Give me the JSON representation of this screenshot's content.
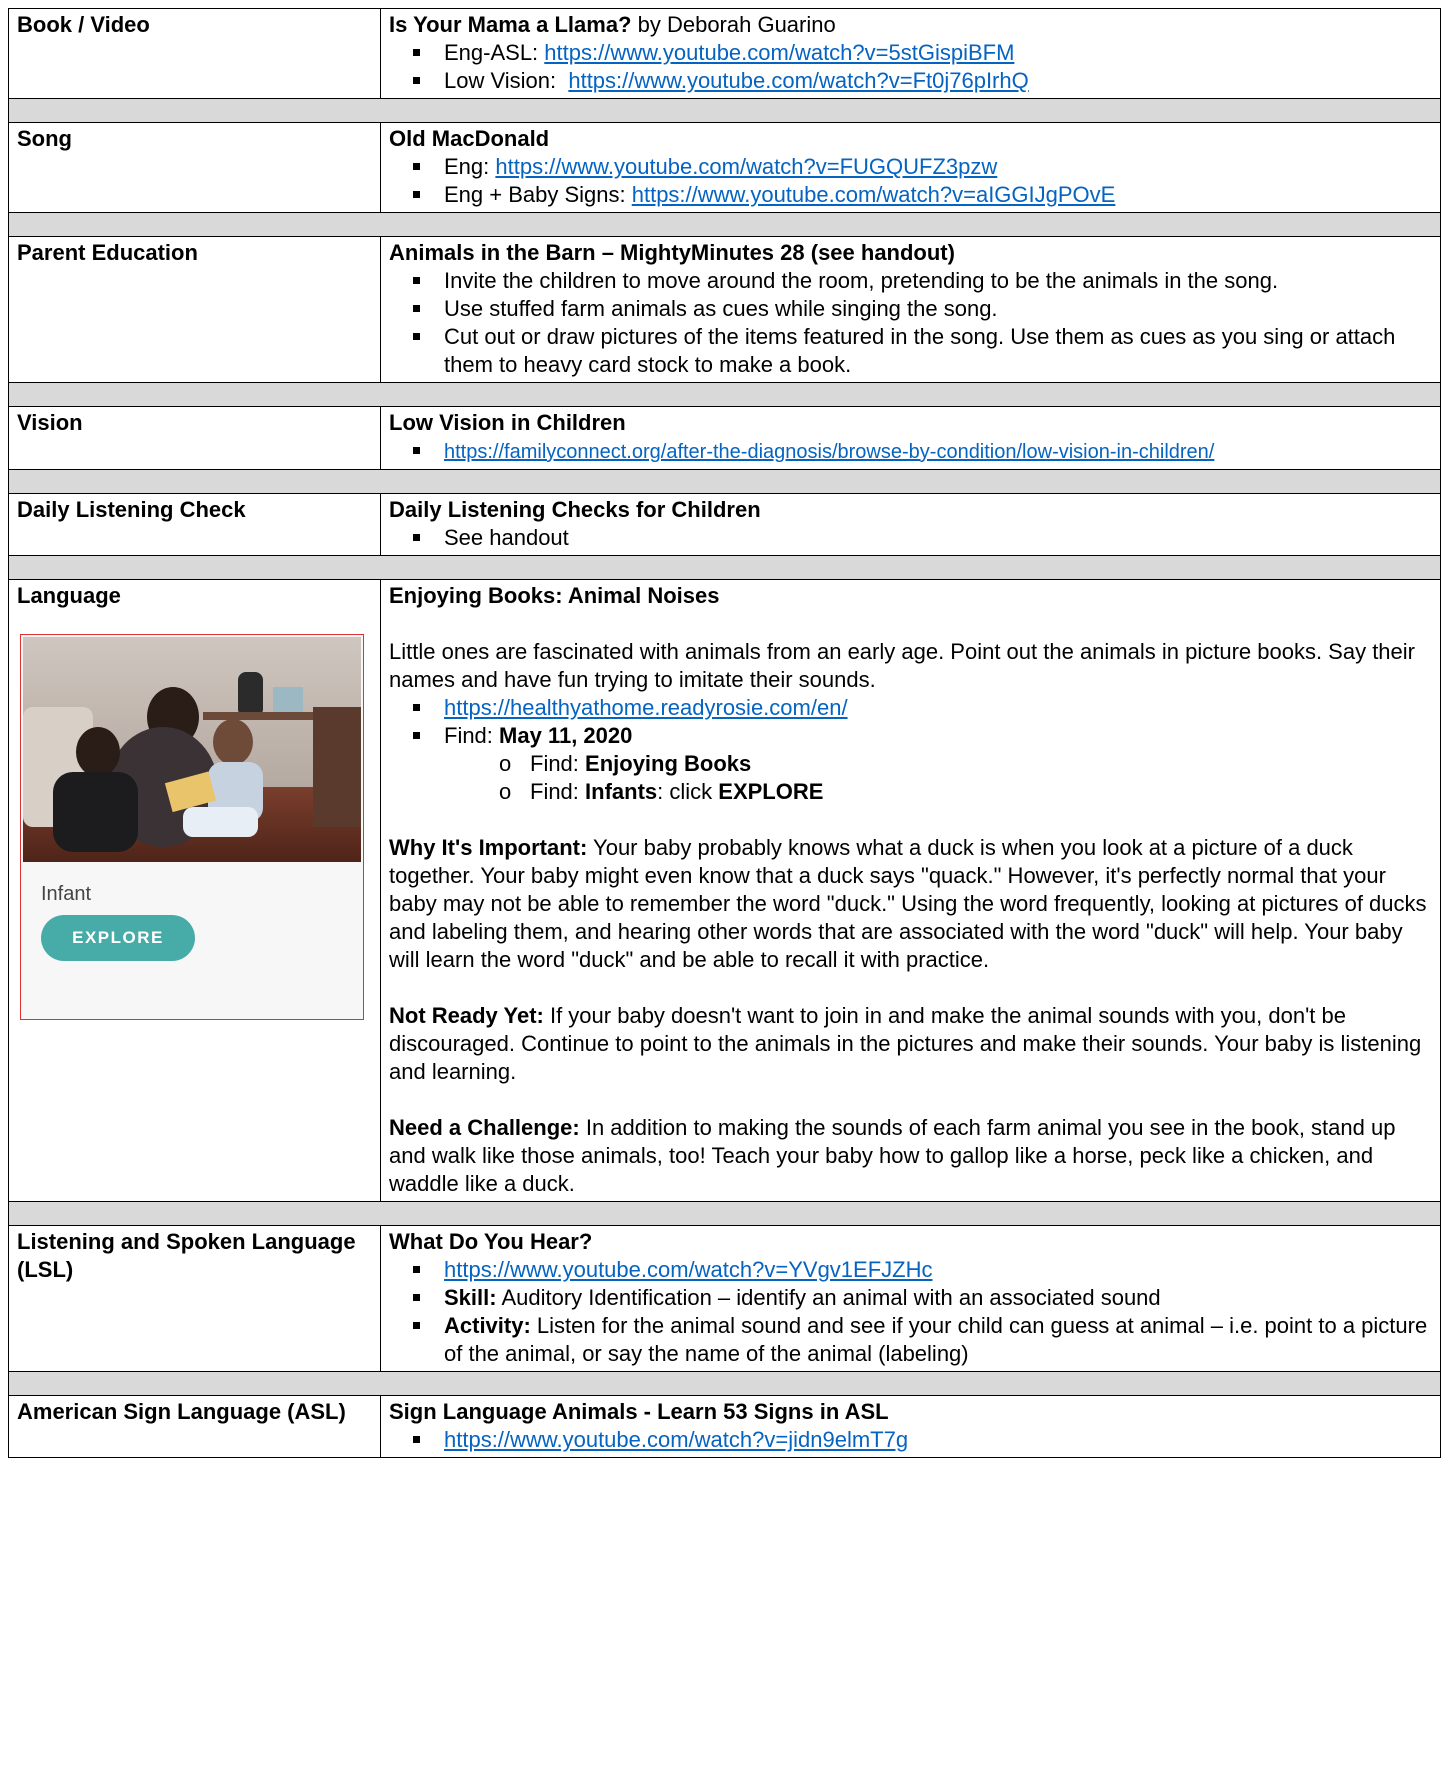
{
  "rows": {
    "book": {
      "label": "Book / Video",
      "title": "Is Your Mama a Llama?",
      "author": " by Deborah Guarino",
      "items": [
        {
          "prefix": "Eng-ASL: ",
          "link": "https://www.youtube.com/watch?v=5stGispiBFM"
        },
        {
          "prefix": "Low Vision:  ",
          "link": "https://www.youtube.com/watch?v=Ft0j76pIrhQ"
        }
      ]
    },
    "song": {
      "label": "Song",
      "title": "Old MacDonald",
      "items": [
        {
          "prefix": "Eng: ",
          "link": "https://www.youtube.com/watch?v=FUGQUFZ3pzw"
        },
        {
          "prefix": "Eng + Baby Signs: ",
          "link": "https://www.youtube.com/watch?v=aIGGIJgPOvE"
        }
      ]
    },
    "parent": {
      "label": "Parent Education",
      "title": "Animals in the Barn – MightyMinutes 28 (see handout)",
      "items": [
        "Invite the children to move around the room, pretending to be the animals in the song.",
        "Use stuffed farm animals as cues while singing the song.",
        "Cut out or draw pictures of the items featured in the song. Use them as cues as you sing or attach them to heavy card stock to make a book."
      ]
    },
    "vision": {
      "label": "Vision",
      "title": "Low Vision in Children",
      "link": "https://familyconnect.org/after-the-diagnosis/browse-by-condition/low-vision-in-children/"
    },
    "listening": {
      "label": "Daily Listening Check",
      "title": "Daily Listening Checks for Children",
      "item": "See handout"
    },
    "language": {
      "label": "Language",
      "card": {
        "caption": "Infant",
        "button": "EXPLORE"
      },
      "title": "Enjoying Books: Animal Noises",
      "intro": "Little ones are fascinated with animals from an early age. Point out the animals in picture books. Say their names and have fun trying to imitate their sounds.",
      "link": "https://healthyathome.readyrosie.com/en/",
      "find_prefix": "Find: ",
      "find_date": "May 11, 2020",
      "sub": [
        {
          "prefix": "Find: ",
          "bold": "Enjoying Books",
          "rest": ""
        },
        {
          "prefix": "Find: ",
          "bold": "Infants",
          "rest": ": click ",
          "bold2": "EXPLORE"
        }
      ],
      "why_label": "Why It's Important:",
      "why_text": " Your baby probably knows what a duck is when you look at a picture of a duck together. Your baby might even know that a duck says \"quack.\" However, it's perfectly normal that your baby may not be able to remember the word \"duck.\" Using the word frequently, looking at pictures of ducks and labeling them, and hearing other words that are associated with the word \"duck\" will help. Your baby will learn the word \"duck\" and be able to recall it with practice.",
      "notready_label": "Not Ready Yet:",
      "notready_text": " If your baby doesn't want to join in and make the animal sounds with you, don't be discouraged. Continue to point to the animals in the pictures and make their sounds. Your baby is listening and learning.",
      "challenge_label": "Need a Challenge:",
      "challenge_text": " In addition to making the sounds of each farm animal you see in the book, stand up and walk like those animals, too! Teach your baby how to gallop like a horse, peck like a chicken, and waddle like a duck."
    },
    "lsl": {
      "label": "Listening and Spoken Language (LSL)",
      "title": "What Do You Hear?",
      "link": "https://www.youtube.com/watch?v=YVgv1EFJZHc",
      "skill_label": "Skill:",
      "skill_text": " Auditory Identification – identify an animal with an associated sound",
      "activity_label": "Activity:",
      "activity_text": " Listen for the animal sound and see if your child can guess at animal – i.e. point to a picture of the animal, or say the name of the animal (labeling)"
    },
    "asl": {
      "label": "American Sign Language (ASL)",
      "title": "Sign Language Animals - Learn 53 Signs in ASL",
      "link": "https://www.youtube.com/watch?v=jidn9elmT7g"
    }
  },
  "colors": {
    "link": "#0563c1",
    "separator": "#d9d9d9",
    "button": "#47aba8",
    "card_border": "#dd3333"
  }
}
